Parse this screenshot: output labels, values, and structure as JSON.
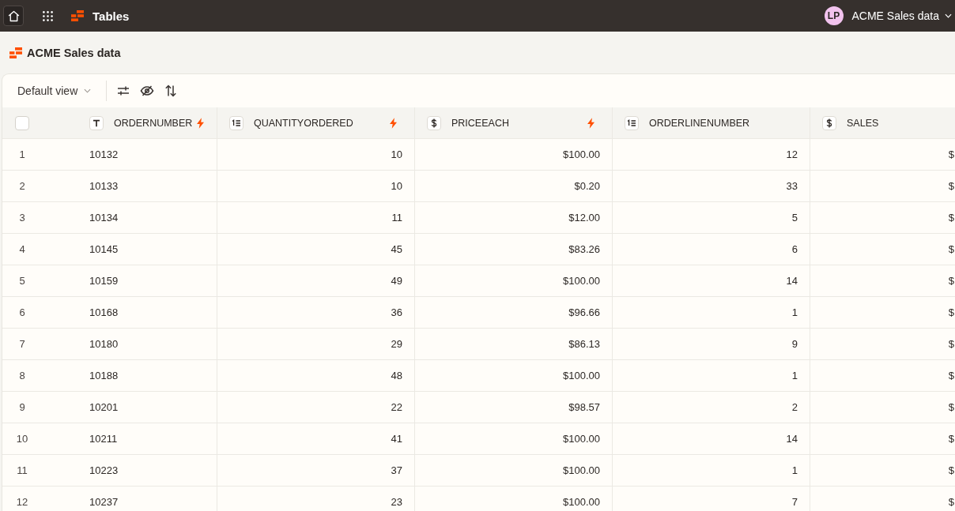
{
  "top_bar": {
    "app_title": "Tables",
    "avatar": "LP",
    "account": "ACME Sales data"
  },
  "page": {
    "title": "ACME Sales data"
  },
  "toolbar": {
    "view": "Default view"
  },
  "table": {
    "select_all": {
      "checked": false
    },
    "columns": [
      {
        "label": "ORDERNUMBER",
        "kind": "text",
        "bolt": true
      },
      {
        "label": "QUANTITYORDERED",
        "kind": "number",
        "bolt": true
      },
      {
        "label": "PRICEEACH",
        "kind": "currency",
        "bolt": true
      },
      {
        "label": "ORDERLINENUMBER",
        "kind": "number",
        "bolt": false
      },
      {
        "label": "SALES",
        "kind": "currency",
        "bolt": false
      }
    ],
    "rows": [
      {
        "number": "1",
        "cells": [
          "10132",
          "10",
          "$100.00",
          "12",
          "$"
        ]
      },
      {
        "number": "2",
        "cells": [
          "10133",
          "10",
          "$0.20",
          "33",
          "$"
        ]
      },
      {
        "number": "3",
        "cells": [
          "10134",
          "11",
          "$12.00",
          "5",
          "$"
        ]
      },
      {
        "number": "4",
        "cells": [
          "10145",
          "45",
          "$83.26",
          "6",
          "$"
        ]
      },
      {
        "number": "5",
        "cells": [
          "10159",
          "49",
          "$100.00",
          "14",
          "$"
        ]
      },
      {
        "number": "6",
        "cells": [
          "10168",
          "36",
          "$96.66",
          "1",
          "$"
        ]
      },
      {
        "number": "7",
        "cells": [
          "10180",
          "29",
          "$86.13",
          "9",
          "$"
        ]
      },
      {
        "number": "8",
        "cells": [
          "10188",
          "48",
          "$100.00",
          "1",
          "$"
        ]
      },
      {
        "number": "9",
        "cells": [
          "10201",
          "22",
          "$98.57",
          "2",
          "$"
        ]
      },
      {
        "number": "10",
        "cells": [
          "10211",
          "41",
          "$100.00",
          "14",
          "$"
        ]
      },
      {
        "number": "11",
        "cells": [
          "10223",
          "37",
          "$100.00",
          "1",
          "$"
        ]
      },
      {
        "number": "12",
        "cells": [
          "10237",
          "23",
          "$100.00",
          "7",
          "$"
        ]
      }
    ]
  }
}
